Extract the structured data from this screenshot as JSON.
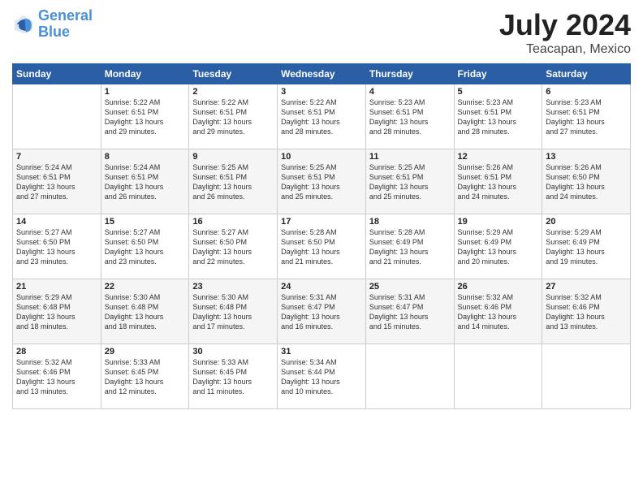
{
  "header": {
    "logo_line1": "General",
    "logo_line2": "Blue",
    "month": "July 2024",
    "location": "Teacapan, Mexico"
  },
  "days_of_week": [
    "Sunday",
    "Monday",
    "Tuesday",
    "Wednesday",
    "Thursday",
    "Friday",
    "Saturday"
  ],
  "weeks": [
    [
      {
        "day": "",
        "content": ""
      },
      {
        "day": "1",
        "content": "Sunrise: 5:22 AM\nSunset: 6:51 PM\nDaylight: 13 hours\nand 29 minutes."
      },
      {
        "day": "2",
        "content": "Sunrise: 5:22 AM\nSunset: 6:51 PM\nDaylight: 13 hours\nand 29 minutes."
      },
      {
        "day": "3",
        "content": "Sunrise: 5:22 AM\nSunset: 6:51 PM\nDaylight: 13 hours\nand 28 minutes."
      },
      {
        "day": "4",
        "content": "Sunrise: 5:23 AM\nSunset: 6:51 PM\nDaylight: 13 hours\nand 28 minutes."
      },
      {
        "day": "5",
        "content": "Sunrise: 5:23 AM\nSunset: 6:51 PM\nDaylight: 13 hours\nand 28 minutes."
      },
      {
        "day": "6",
        "content": "Sunrise: 5:23 AM\nSunset: 6:51 PM\nDaylight: 13 hours\nand 27 minutes."
      }
    ],
    [
      {
        "day": "7",
        "content": "Sunrise: 5:24 AM\nSunset: 6:51 PM\nDaylight: 13 hours\nand 27 minutes."
      },
      {
        "day": "8",
        "content": "Sunrise: 5:24 AM\nSunset: 6:51 PM\nDaylight: 13 hours\nand 26 minutes."
      },
      {
        "day": "9",
        "content": "Sunrise: 5:25 AM\nSunset: 6:51 PM\nDaylight: 13 hours\nand 26 minutes."
      },
      {
        "day": "10",
        "content": "Sunrise: 5:25 AM\nSunset: 6:51 PM\nDaylight: 13 hours\nand 25 minutes."
      },
      {
        "day": "11",
        "content": "Sunrise: 5:25 AM\nSunset: 6:51 PM\nDaylight: 13 hours\nand 25 minutes."
      },
      {
        "day": "12",
        "content": "Sunrise: 5:26 AM\nSunset: 6:51 PM\nDaylight: 13 hours\nand 24 minutes."
      },
      {
        "day": "13",
        "content": "Sunrise: 5:26 AM\nSunset: 6:50 PM\nDaylight: 13 hours\nand 24 minutes."
      }
    ],
    [
      {
        "day": "14",
        "content": "Sunrise: 5:27 AM\nSunset: 6:50 PM\nDaylight: 13 hours\nand 23 minutes."
      },
      {
        "day": "15",
        "content": "Sunrise: 5:27 AM\nSunset: 6:50 PM\nDaylight: 13 hours\nand 23 minutes."
      },
      {
        "day": "16",
        "content": "Sunrise: 5:27 AM\nSunset: 6:50 PM\nDaylight: 13 hours\nand 22 minutes."
      },
      {
        "day": "17",
        "content": "Sunrise: 5:28 AM\nSunset: 6:50 PM\nDaylight: 13 hours\nand 21 minutes."
      },
      {
        "day": "18",
        "content": "Sunrise: 5:28 AM\nSunset: 6:49 PM\nDaylight: 13 hours\nand 21 minutes."
      },
      {
        "day": "19",
        "content": "Sunrise: 5:29 AM\nSunset: 6:49 PM\nDaylight: 13 hours\nand 20 minutes."
      },
      {
        "day": "20",
        "content": "Sunrise: 5:29 AM\nSunset: 6:49 PM\nDaylight: 13 hours\nand 19 minutes."
      }
    ],
    [
      {
        "day": "21",
        "content": "Sunrise: 5:29 AM\nSunset: 6:48 PM\nDaylight: 13 hours\nand 18 minutes."
      },
      {
        "day": "22",
        "content": "Sunrise: 5:30 AM\nSunset: 6:48 PM\nDaylight: 13 hours\nand 18 minutes."
      },
      {
        "day": "23",
        "content": "Sunrise: 5:30 AM\nSunset: 6:48 PM\nDaylight: 13 hours\nand 17 minutes."
      },
      {
        "day": "24",
        "content": "Sunrise: 5:31 AM\nSunset: 6:47 PM\nDaylight: 13 hours\nand 16 minutes."
      },
      {
        "day": "25",
        "content": "Sunrise: 5:31 AM\nSunset: 6:47 PM\nDaylight: 13 hours\nand 15 minutes."
      },
      {
        "day": "26",
        "content": "Sunrise: 5:32 AM\nSunset: 6:46 PM\nDaylight: 13 hours\nand 14 minutes."
      },
      {
        "day": "27",
        "content": "Sunrise: 5:32 AM\nSunset: 6:46 PM\nDaylight: 13 hours\nand 13 minutes."
      }
    ],
    [
      {
        "day": "28",
        "content": "Sunrise: 5:32 AM\nSunset: 6:46 PM\nDaylight: 13 hours\nand 13 minutes."
      },
      {
        "day": "29",
        "content": "Sunrise: 5:33 AM\nSunset: 6:45 PM\nDaylight: 13 hours\nand 12 minutes."
      },
      {
        "day": "30",
        "content": "Sunrise: 5:33 AM\nSunset: 6:45 PM\nDaylight: 13 hours\nand 11 minutes."
      },
      {
        "day": "31",
        "content": "Sunrise: 5:34 AM\nSunset: 6:44 PM\nDaylight: 13 hours\nand 10 minutes."
      },
      {
        "day": "",
        "content": ""
      },
      {
        "day": "",
        "content": ""
      },
      {
        "day": "",
        "content": ""
      }
    ]
  ]
}
